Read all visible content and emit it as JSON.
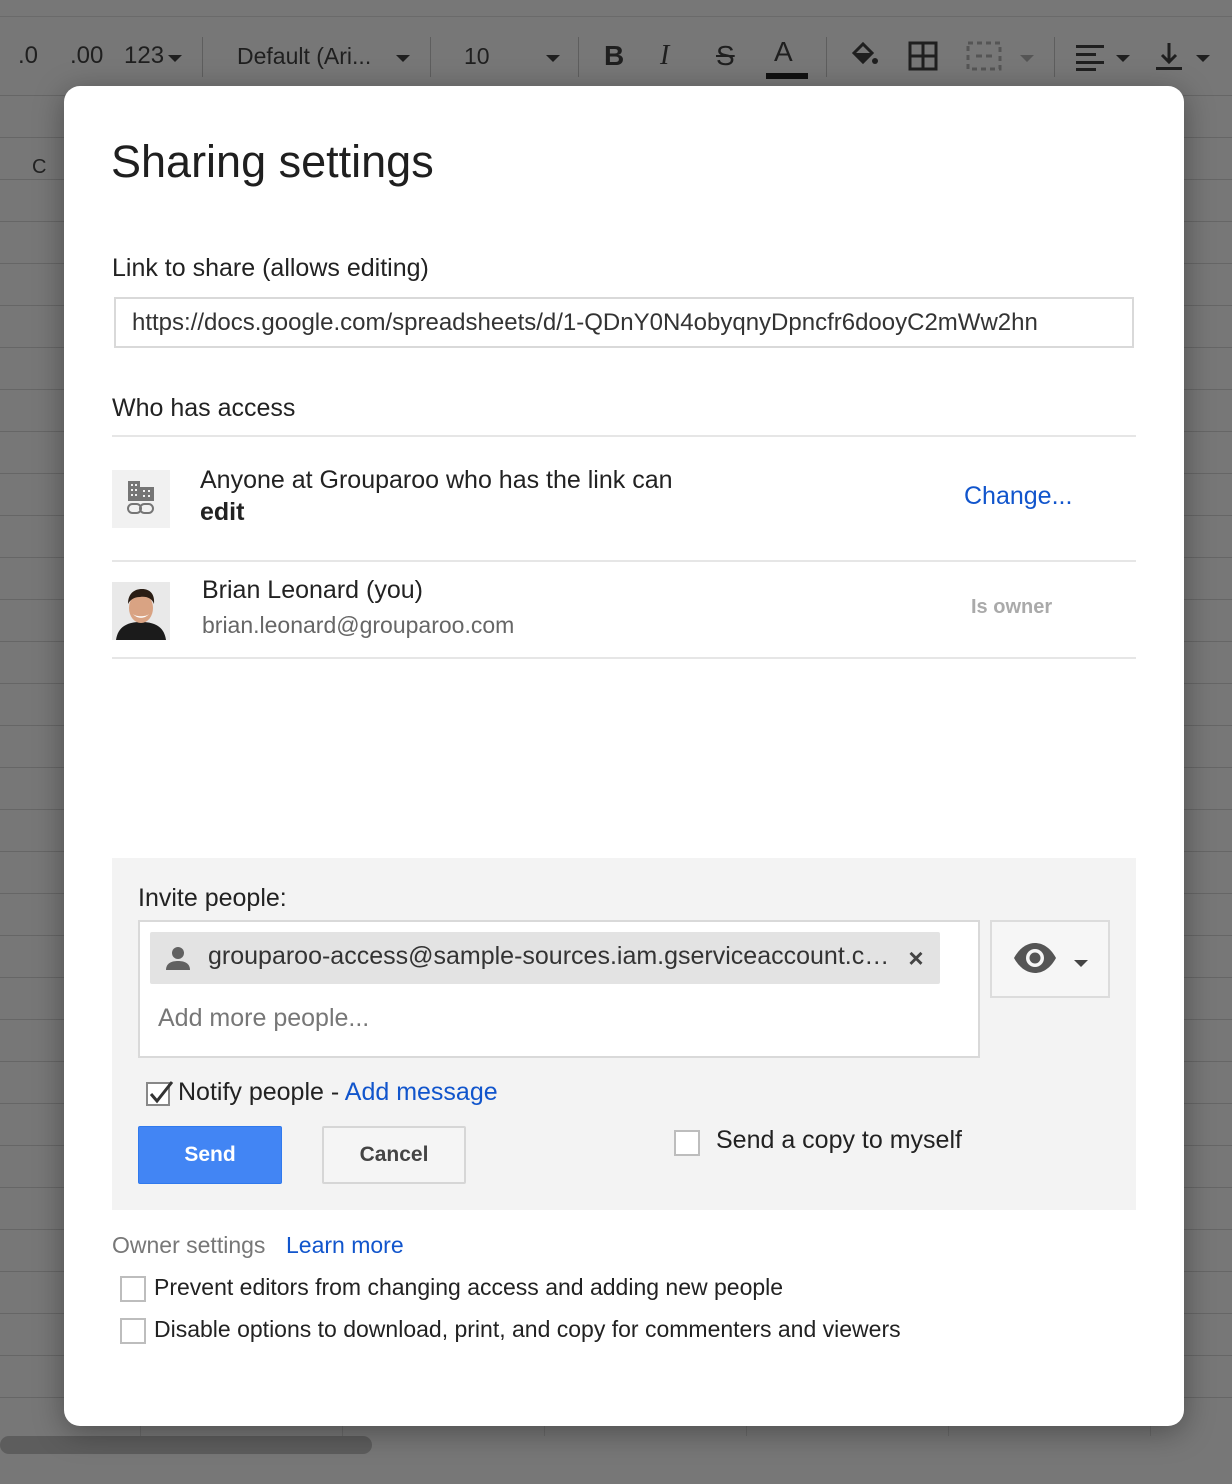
{
  "background": {
    "toolbar": {
      "decimal_decrease": ".0",
      "decimal_increase": ".00",
      "number_format": "123",
      "font_family": "Default (Ari...",
      "font_size": "10",
      "bold": "B",
      "italic": "I",
      "strikethrough": "S",
      "text_color": "A"
    },
    "column_header": "C"
  },
  "dialog": {
    "title": "Sharing settings",
    "link": {
      "label": "Link to share (allows editing)",
      "url": "https://docs.google.com/spreadsheets/d/1-QDnY0N4obyqnyDpncfr6dooyC2mWw2hn"
    },
    "who_has_access": {
      "label": "Who has access",
      "entries": [
        {
          "icon": "domain-link-icon",
          "text": "Anyone at Grouparoo who has the link can",
          "permission": "edit",
          "action": "Change..."
        },
        {
          "name": "Brian Leonard (you)",
          "email": "brian.leonard@grouparoo.com",
          "role": "Is owner"
        }
      ]
    },
    "invite": {
      "label": "Invite people:",
      "chip_email": "grouparoo-access@sample-sources.iam.gserviceaccount.com",
      "chip_close": "×",
      "placeholder": "Add more people...",
      "permission_icon": "eye-icon",
      "notify_label": "Notify people - ",
      "notify_checked": true,
      "add_message": "Add message",
      "send": "Send",
      "cancel": "Cancel",
      "send_copy": "Send a copy to myself"
    },
    "owner_settings": {
      "label": "Owner settings",
      "learn_more": "Learn more",
      "options": [
        "Prevent editors from changing access and adding new people",
        "Disable options to download, print, and copy for commenters and viewers"
      ]
    }
  }
}
